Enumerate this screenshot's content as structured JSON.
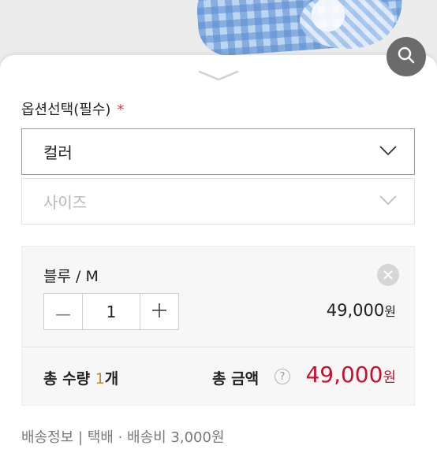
{
  "option_section": {
    "title": "옵션선택(필수)",
    "required_mark": "*",
    "color_select": {
      "value": "컬러"
    },
    "size_select": {
      "placeholder": "사이즈"
    }
  },
  "selected_item": {
    "name": "블루 / M",
    "quantity": "1",
    "price": "49,000",
    "currency": "원",
    "decrement": "−",
    "increment": "+"
  },
  "summary": {
    "total_qty_label": "총 수량",
    "total_qty_num": "1",
    "total_qty_unit": "개",
    "total_amount_label": "총 금액",
    "help": "?",
    "total_amount": "49,000",
    "currency": "원"
  },
  "shipping_info": "배송정보 | 택배 · 배송비 3,000원",
  "colors": {
    "accent_red": "#c8102e",
    "required_red": "#e0373a",
    "qty_gold": "#c28a2b"
  },
  "icons": [
    "search-icon",
    "sheet-handle-icon",
    "chevron-down-icon",
    "close-icon",
    "minus-icon",
    "plus-icon",
    "help-icon"
  ]
}
